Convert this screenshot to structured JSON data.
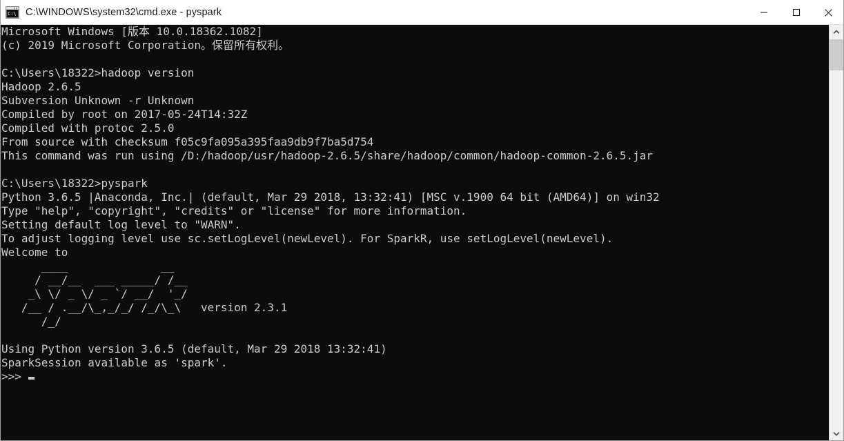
{
  "window": {
    "title": "C:\\WINDOWS\\system32\\cmd.exe - pyspark",
    "icon": "cmd-console-icon",
    "background_color": "#0c0c0c",
    "text_color": "#cccccc",
    "titlebar_color": "#ffffff"
  },
  "window_controls": {
    "minimize_label": "—",
    "maximize_label": "□",
    "close_label": "✕"
  },
  "scrollbar": {
    "up_arrow": "∧",
    "down_arrow": "∨",
    "thumb_position": "top"
  },
  "terminal": {
    "lines": [
      "Microsoft Windows [版本 10.0.18362.1082]",
      "(c) 2019 Microsoft Corporation。保留所有权利。",
      "",
      "C:\\Users\\18322>hadoop version",
      "Hadoop 2.6.5",
      "Subversion Unknown -r Unknown",
      "Compiled by root on 2017-05-24T14:32Z",
      "Compiled with protoc 2.5.0",
      "From source with checksum f05c9fa095a395faa9db9f7ba5d754",
      "This command was run using /D:/hadoop/usr/hadoop-2.6.5/share/hadoop/common/hadoop-common-2.6.5.jar",
      "",
      "C:\\Users\\18322>pyspark",
      "Python 3.6.5 |Anaconda, Inc.| (default, Mar 29 2018, 13:32:41) [MSC v.1900 64 bit (AMD64)] on win32",
      "Type \"help\", \"copyright\", \"credits\" or \"license\" for more information.",
      "Setting default log level to \"WARN\".",
      "To adjust logging level use sc.setLogLevel(newLevel). For SparkR, use setLogLevel(newLevel).",
      "Welcome to"
    ],
    "spark_logo": [
      "      ____              __",
      "     / __/__  ___ _____/ /__",
      "    _\\ \\/ _ \\/ _ `/ __/  '_/",
      "   /__ / .__/\\_,_/_/ /_/\\_\\   version 2.3.1",
      "      /_/"
    ],
    "tail_lines": [
      "",
      "Using Python version 3.6.5 (default, Mar 29 2018 13:32:41)",
      "SparkSession available as 'spark'."
    ],
    "prompt": ">>>",
    "cursor": "block"
  },
  "details": {
    "hadoop_version": "2.6.5",
    "spark_version": "2.3.1",
    "python_version": "3.6.5",
    "windows_build": "10.0.18362.1082",
    "user_directory": "C:\\Users\\18322"
  }
}
